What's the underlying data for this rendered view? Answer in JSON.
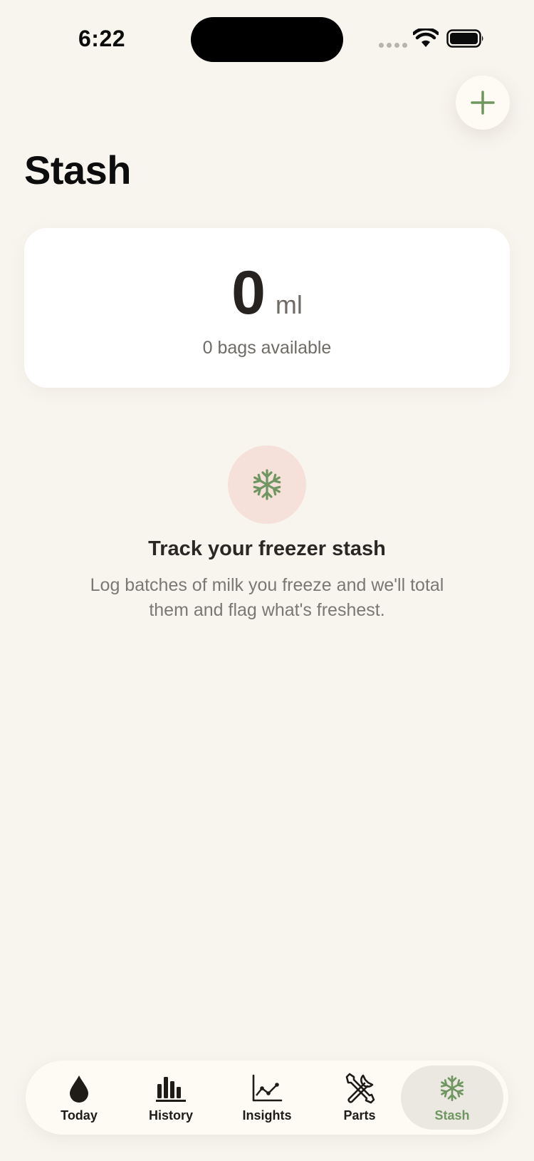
{
  "status_bar": {
    "time": "6:22"
  },
  "header": {
    "title": "Stash",
    "add_icon": "plus-icon"
  },
  "summary": {
    "total_value": "0",
    "unit": "ml",
    "bags_text": "0 bags available"
  },
  "empty_state": {
    "icon": "snowflake-icon",
    "title": "Track your freezer stash",
    "description": "Log batches of milk you freeze and we'll total them and flag what's freshest."
  },
  "tabs": [
    {
      "label": "Today",
      "icon": "drop-icon",
      "active": false
    },
    {
      "label": "History",
      "icon": "bar-chart-icon",
      "active": false
    },
    {
      "label": "Insights",
      "icon": "line-chart-icon",
      "active": false
    },
    {
      "label": "Parts",
      "icon": "tools-icon",
      "active": false
    },
    {
      "label": "Stash",
      "icon": "snowflake-icon",
      "active": true
    }
  ],
  "colors": {
    "accent": "#6f9660",
    "background": "#f8f5ef",
    "empty_icon_bg": "#f6e1da"
  }
}
